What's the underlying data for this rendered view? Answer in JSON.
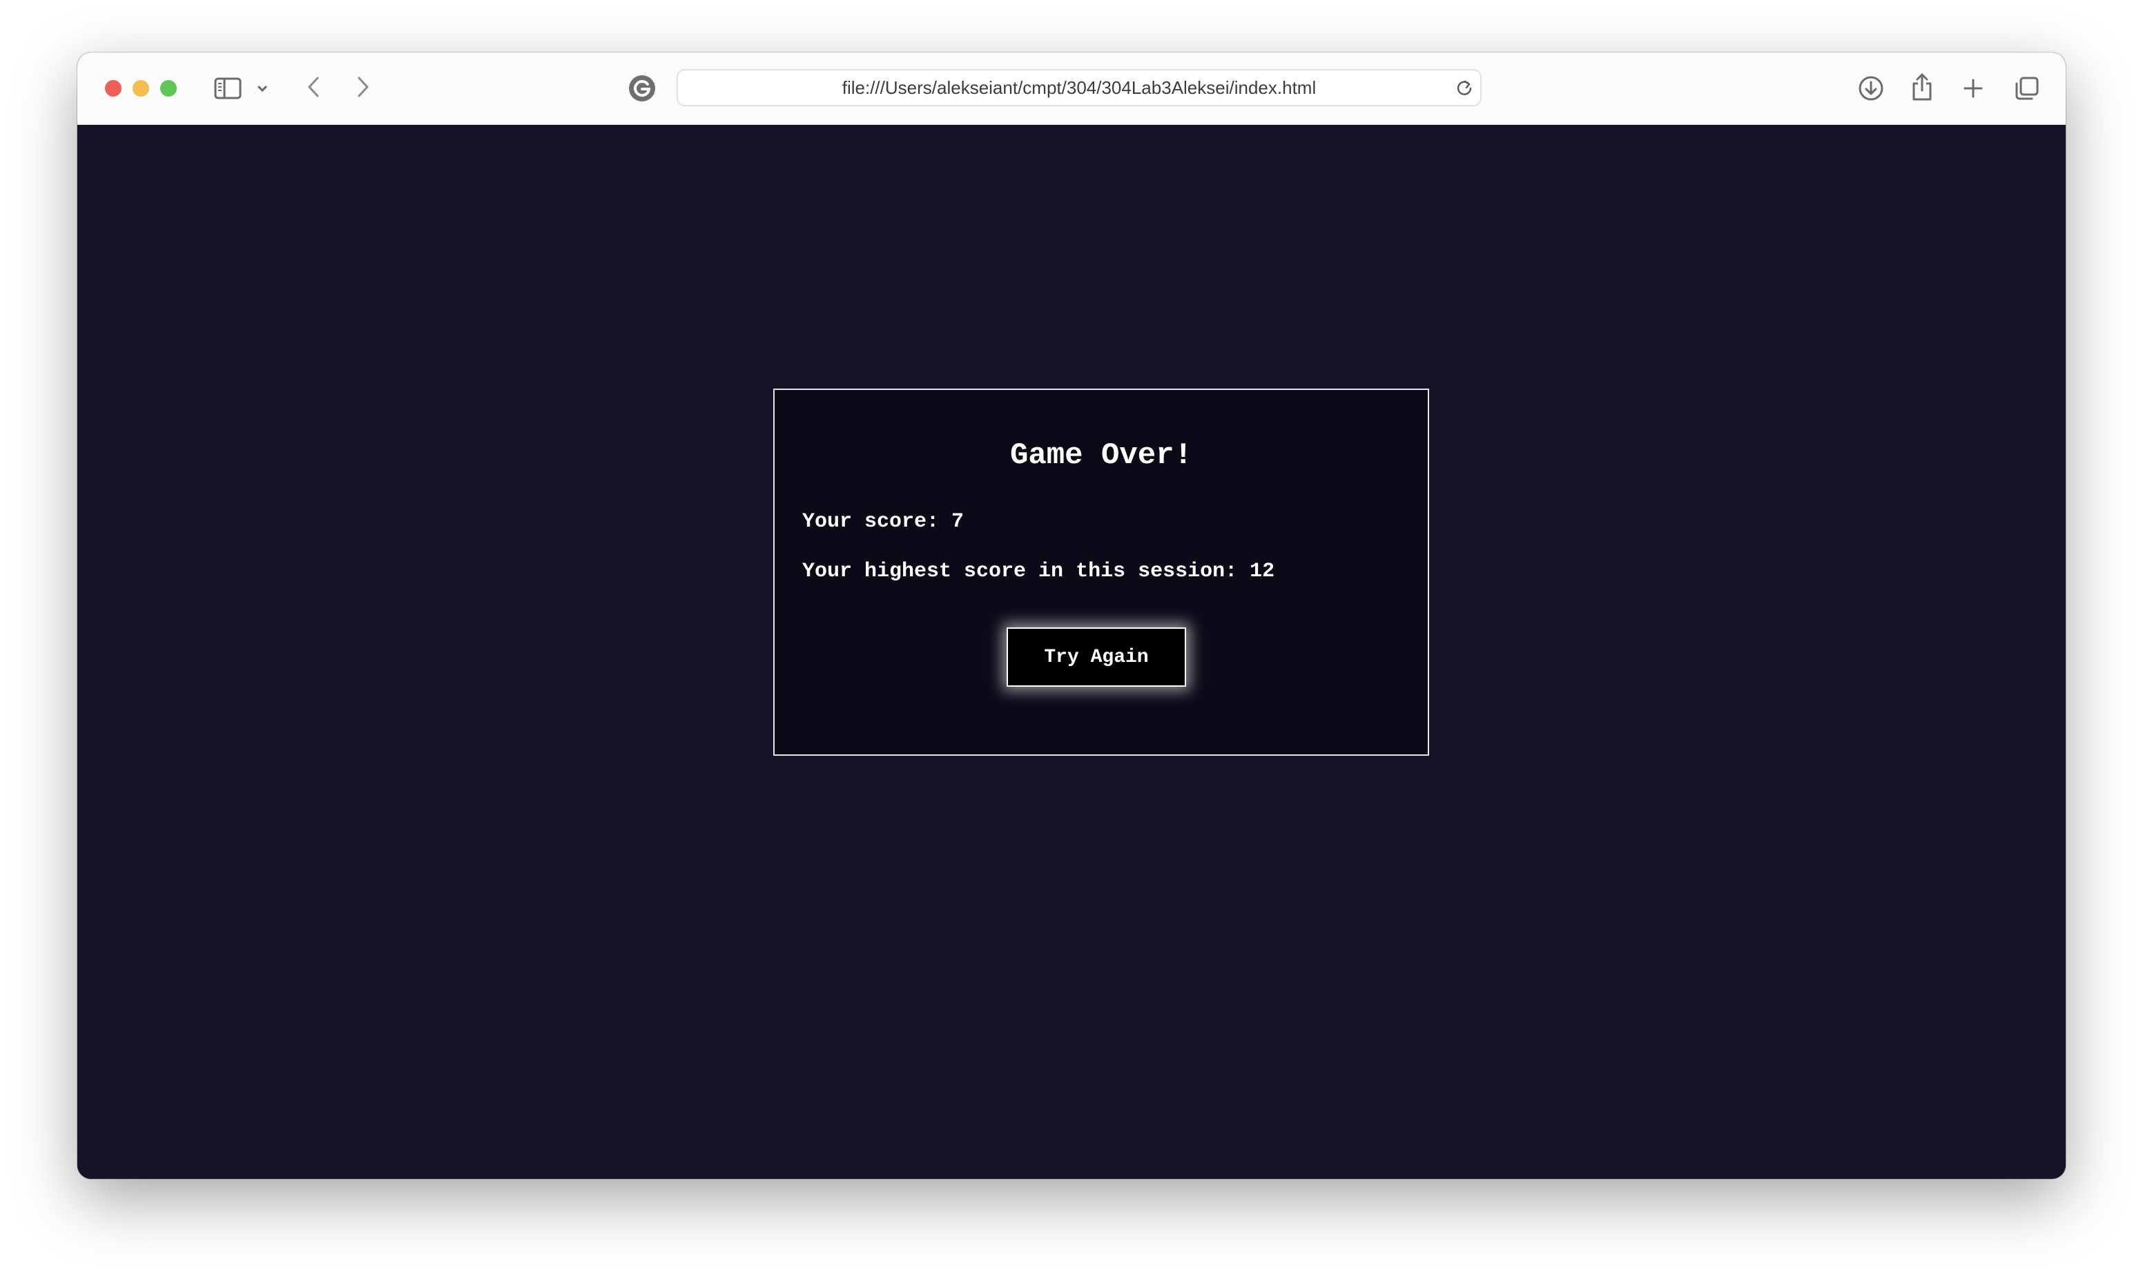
{
  "browser": {
    "url": "file:///Users/alekseiant/cmpt/304/304Lab3Aleksei/index.html",
    "icons": {
      "close": "close-icon",
      "minimize": "minimize-icon",
      "zoom": "zoom-icon",
      "sidebar": "sidebar-icon",
      "chevron": "chevron-down-icon",
      "back": "back-icon",
      "forward": "forward-icon",
      "extension": "grammarly-icon",
      "reload": "reload-icon",
      "download": "download-icon",
      "share": "share-icon",
      "new_tab": "plus-icon",
      "tabs": "tab-overview-icon"
    },
    "colors": {
      "toolbar_bg": "#fbfbfb",
      "page_bg": "#151327"
    }
  },
  "game_over": {
    "title": "Game Over!",
    "score_text": "Your score: 7",
    "high_score_text": "Your highest score in this session: 12",
    "button_label": "Try Again",
    "colors": {
      "panel_bg": "#0b0a17",
      "text": "#ffffff",
      "button_bg": "#000000"
    }
  }
}
